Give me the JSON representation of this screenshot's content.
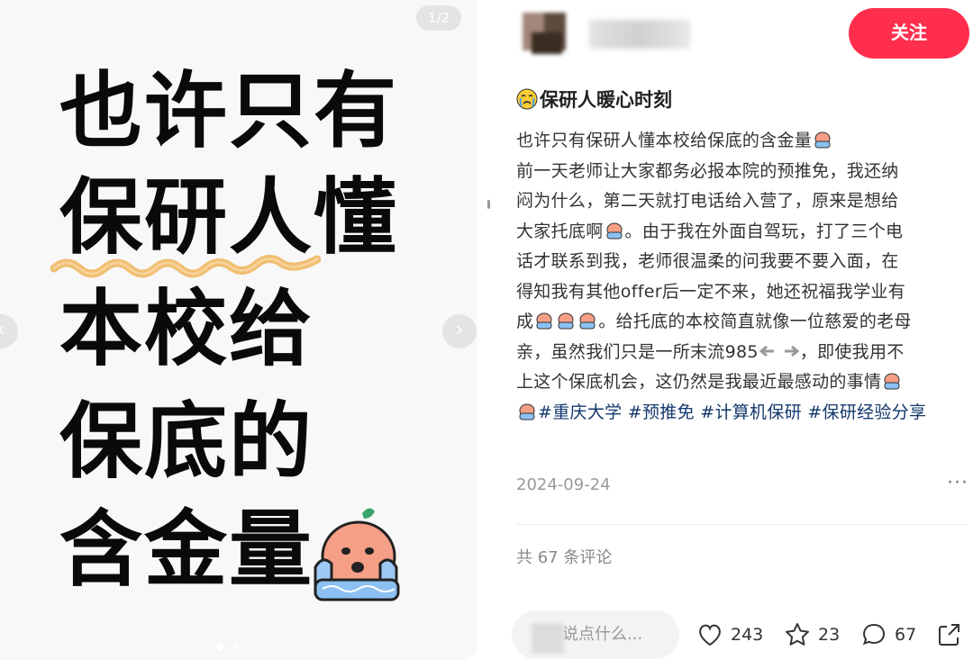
{
  "image_panel": {
    "page_counter": "1/2",
    "poster_lines": [
      "也许只有",
      "保研人懂",
      "本校给",
      "保底的",
      "含金量"
    ],
    "prev_arrow": "‹",
    "next_arrow": "›",
    "current_slide": 1,
    "total_slides": 2
  },
  "author": {
    "follow_label": "关注"
  },
  "post": {
    "title": "保研人暖心时刻",
    "body_lines": [
      "也许只有保研人懂本校给保底的含金量",
      "前一天老师让大家都务必报本院的预推免，我还纳",
      "闷为什么，第二天就打电话给入营了，原来是想给",
      "大家托底啊",
      "。由于我在外面自驾玩，打了三个电",
      "话才联系到我，老师很温柔的问我要不要入面，在",
      "得知我有其他offer后一定不来，她还祝福我学业有",
      "成",
      "。给托底的本校简直就像一位慈爱的老母",
      "亲，虽然我们只是一所末流985",
      "，即使我用不",
      "上这个保底机会，这仍然是我最近最感动的事情"
    ],
    "hashtags": [
      "#重庆大学",
      "#预推免",
      "#计算机保研",
      "#保研经验分享"
    ],
    "date": "2024-09-24",
    "more_label": "···"
  },
  "comments": {
    "count_text": "共 67 条评论",
    "input_placeholder": "说点什么..."
  },
  "actions": {
    "likes": "243",
    "collects": "23",
    "comments": "67"
  },
  "colors": {
    "follow_button": "#ff2e4d",
    "hashtag": "#13386c",
    "poster_text": "#0a0a0a",
    "squiggle": "#f0b45a"
  },
  "icons": {
    "title_emoji": "crying-face-icon",
    "sticker": "crying-blob-sticker",
    "like": "heart-icon",
    "collect": "star-icon",
    "comment": "speech-bubble-icon",
    "share": "share-icon",
    "more": "ellipsis-icon",
    "pointing": "pointing-hands-icon"
  }
}
